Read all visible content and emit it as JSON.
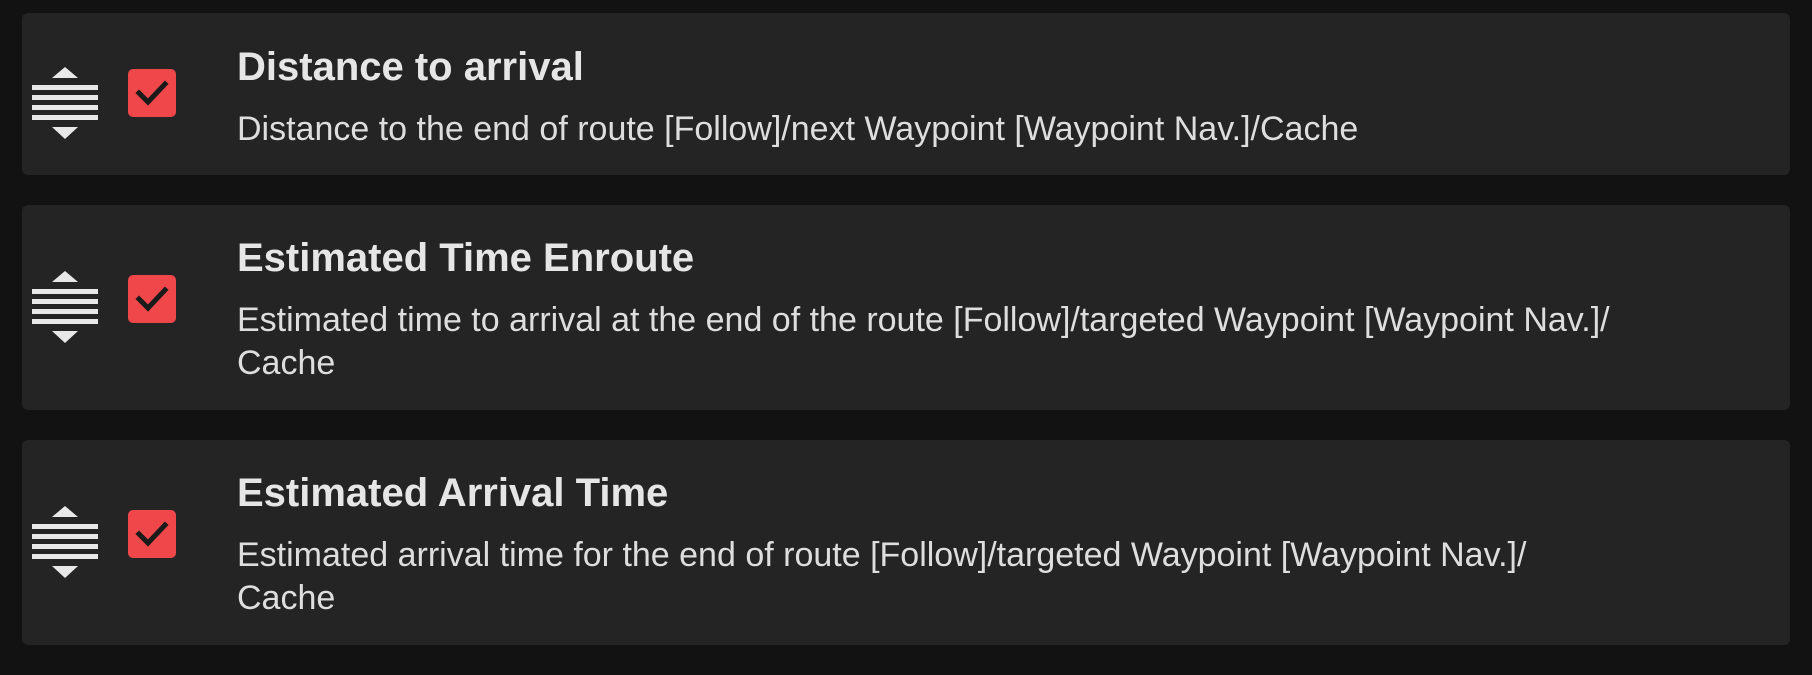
{
  "items": [
    {
      "title": "Distance to arrival",
      "description": "Distance to the end of route [Follow]/next Waypoint [Waypoint Nav.]/Cache",
      "checked": true
    },
    {
      "title": "Estimated Time Enroute",
      "description_line1": "Estimated time to arrival at the end of the route [Follow]/targeted Waypoint [Waypoint Nav.]/",
      "description_line2": "Cache",
      "checked": true
    },
    {
      "title": "Estimated Arrival Time",
      "description_line1": "Estimated arrival time for the end of route [Follow]/targeted Waypoint [Waypoint Nav.]/",
      "description_line2": "Cache",
      "checked": true
    }
  ],
  "colors": {
    "page_background": "#121212",
    "card_background": "#242424",
    "checkbox_accent": "#f0474a",
    "text_primary": "#e6e6e6"
  },
  "icons": {
    "drag_handle": "drag-handle-icon",
    "checkmark": "checkmark-icon"
  }
}
